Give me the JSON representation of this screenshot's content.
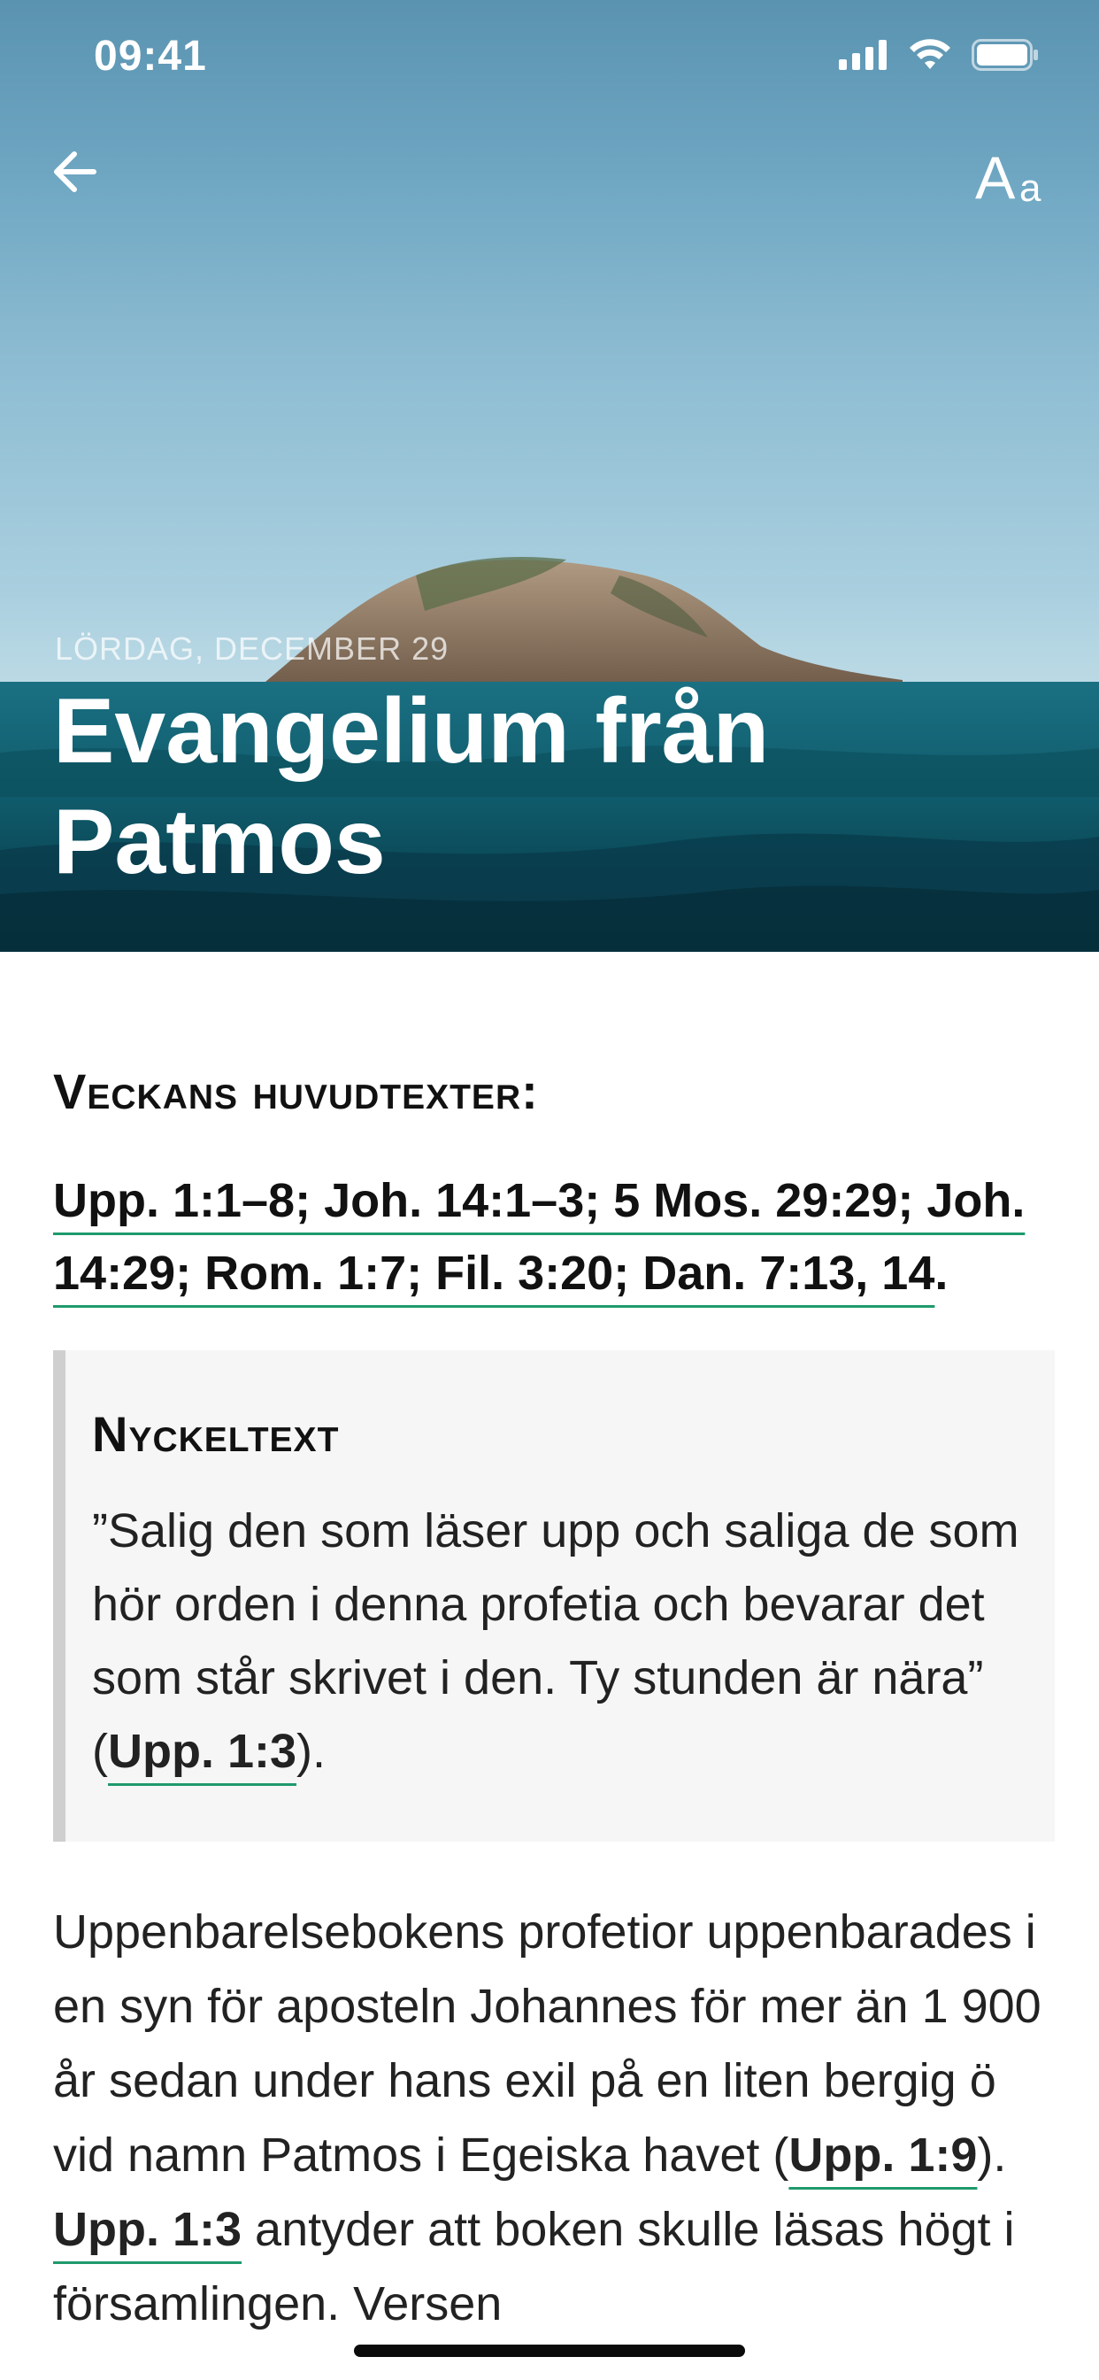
{
  "status_bar": {
    "time": "09:41"
  },
  "header": {
    "back_icon": "arrow-left-icon",
    "font_size_label_big": "A",
    "font_size_label_small": "a"
  },
  "hero": {
    "date": "LÖRDAG, DECEMBER 29",
    "title_line1": "Evangelium från",
    "title_line2": "Patmos"
  },
  "content": {
    "section_heading": "Veckans huvudtexter:",
    "refs_line": "Upp. 1:1–8; Joh. 14:1–3; 5 Mos. 29:29; Joh. 14:29; Rom. 1:7; Fil. 3:20; Dan. 7:13, 14",
    "refs_period": ".",
    "key_heading": "Nyckeltext",
    "key_text": "”Salig den som läser upp och saliga de som hör orden i denna profetia och bevarar det som står skrivet i den. Ty stunden är nära” (",
    "key_ref": "Upp. 1:3",
    "key_end": ").",
    "body_part1": "Uppenbarelsebokens profetior uppenbarades i en syn för aposteln Johannes för mer än 1 900 år sedan under hans exil på en liten bergig ö vid namn Patmos i Egeiska havet (",
    "body_ref1": "Upp. 1:9",
    "body_part2": "). ",
    "body_ref2": "Upp. 1:3",
    "body_part3": " antyder att boken skulle läsas högt i församlingen. Versen"
  },
  "colors": {
    "link_underline": "#1f9a6c",
    "sea": "#0f5a6a",
    "quote_bar": "#cfcfcf"
  }
}
